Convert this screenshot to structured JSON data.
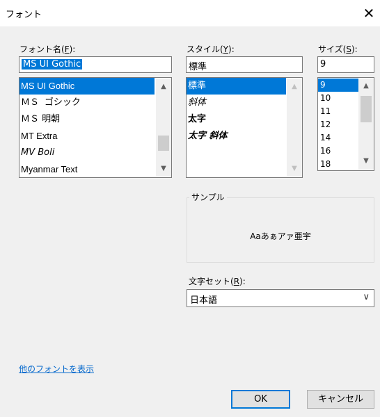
{
  "window": {
    "title": "フォント",
    "close_glyph": "✕"
  },
  "font": {
    "label_pre": "フォント名(",
    "label_key": "F",
    "label_post": "):",
    "value": "MS UI Gothic",
    "items": [
      "MS UI Gothic",
      "ＭＳ ゴシック",
      "ＭＳ 明朝",
      "MT Extra",
      "MV Boli",
      "Myanmar Text"
    ]
  },
  "style": {
    "label_pre": "スタイル(",
    "label_key": "Y",
    "label_post": "):",
    "value": "標準",
    "items": [
      "標準",
      "斜体",
      "太字",
      "太字 斜体"
    ]
  },
  "size": {
    "label_pre": "サイズ(",
    "label_key": "S",
    "label_post": "):",
    "value": "9",
    "items": [
      "9",
      "10",
      "11",
      "12",
      "14",
      "16",
      "18"
    ]
  },
  "sample": {
    "label": "サンプル",
    "text": "Aaあぁアァ亜宇"
  },
  "charset": {
    "label_pre": "文字セット(",
    "label_key": "R",
    "label_post": "):",
    "value": "日本語"
  },
  "link": {
    "more_fonts": "他のフォントを表示"
  },
  "buttons": {
    "ok": "OK",
    "cancel": "キャンセル"
  },
  "icons": {
    "scroll_up": "▲",
    "scroll_down": "▼",
    "combo_arrow": "∨"
  },
  "colors": {
    "selection": "#0078d7",
    "link": "#0066cc",
    "default_button_border": "#0078d7"
  }
}
